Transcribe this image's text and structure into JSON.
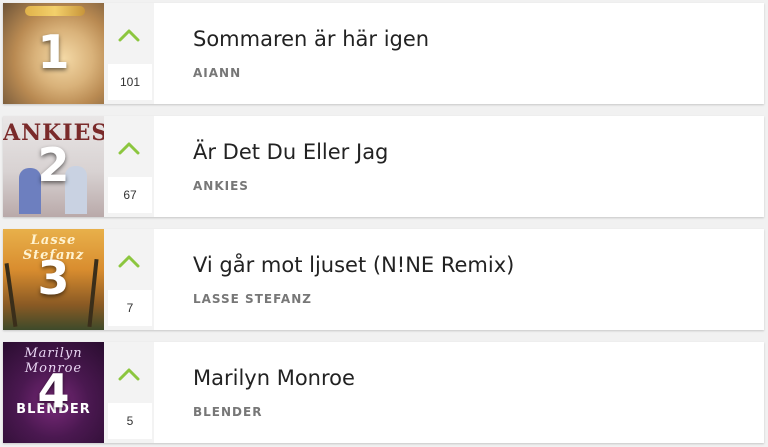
{
  "colors": {
    "up_arrow": "#8cc63f",
    "title": "#222222",
    "artist": "#777777",
    "trend_panel": "#f3f3f3"
  },
  "entries": [
    {
      "rank": "1",
      "title": "Sommaren är här igen",
      "artist": "AIANN",
      "votes": "101",
      "trend_icon": "up-chevron-icon"
    },
    {
      "rank": "2",
      "title": "Är Det Du Eller Jag",
      "artist": "ANKIES",
      "votes": "67",
      "trend_icon": "up-chevron-icon",
      "cover_text": "ANKIES"
    },
    {
      "rank": "3",
      "title": "Vi går mot ljuset (N!NE Remix)",
      "artist": "LASSE STEFANZ",
      "votes": "7",
      "trend_icon": "up-chevron-icon",
      "cover_text": "Lasse Stefanz"
    },
    {
      "rank": "4",
      "title": "Marilyn Monroe",
      "artist": "BLENDER",
      "votes": "5",
      "trend_icon": "up-chevron-icon",
      "cover_text": "Marilyn Monroe",
      "cover_text_2": "BLENDER"
    }
  ]
}
